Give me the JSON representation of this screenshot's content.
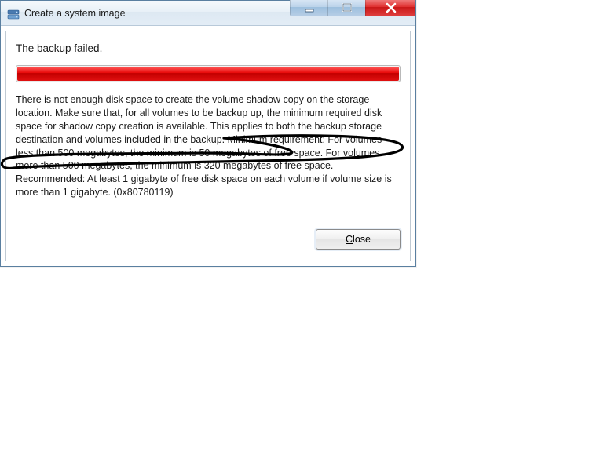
{
  "window": {
    "title": "Create a system image"
  },
  "dialog": {
    "headline": "The backup failed.",
    "message": "There is not enough disk space to create the volume shadow copy on the storage location. Make sure that, for all volumes to be backup up, the minimum required disk space for shadow copy creation is available. This applies to both the backup storage destination and volumes included in the backup. Minimum requirement: For volumes less than 500 megabytes, the minimum is 50 megabytes of free space. For volumes more than 500 megabytes, the minimum is 320 megabytes of free space.  Recommended: At least 1 gigabyte of free disk space on each volume if volume size is more than 1 gigabyte. (0x80780119)",
    "close_label": "Close"
  }
}
